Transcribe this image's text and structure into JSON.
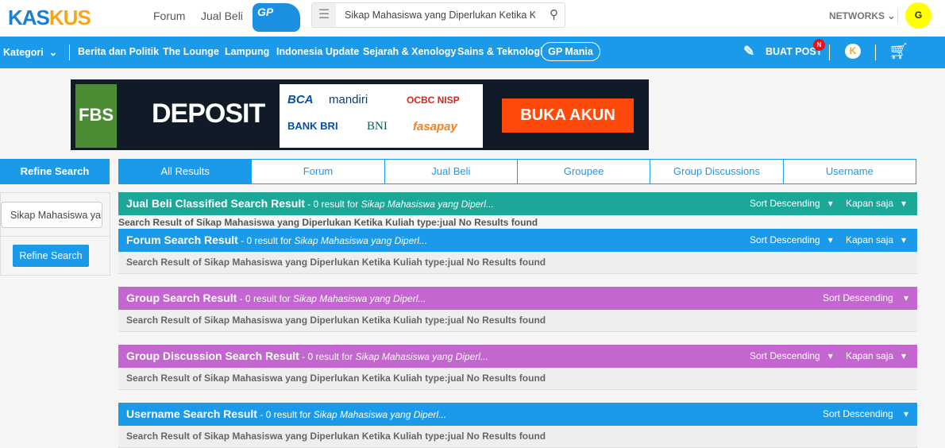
{
  "header": {
    "logo": "KASKUS",
    "links": [
      "Forum",
      "Jual Beli"
    ],
    "gp_logo": "GP",
    "search_value": "Sikap Mahasiswa yang Diperlukan Ketika Ku",
    "networks": "NETWORKS",
    "avatar": "G"
  },
  "nav": {
    "kategori": "Kategori",
    "items": [
      "Berita dan Politik",
      "The Lounge",
      "Lampung",
      "Indonesia Update",
      "Sejarah & Xenology",
      "Sains & Teknologi"
    ],
    "gp_mania": "GP Mania",
    "buat_post": "BUAT POST",
    "badge": "N"
  },
  "ad": {
    "brand": "FBS",
    "title": "DEPOSIT",
    "banks": [
      "BCA",
      "mandiri",
      "OCBC NISP",
      "BANK BRI",
      "BNI",
      "fasapay"
    ],
    "cta": "BUKA AKUN"
  },
  "sidebar": {
    "title": "Refine Search",
    "input_value": "Sikap Mahasiswa yang Diperlukan Ketika Kuliah",
    "button": "Refine Search"
  },
  "tabs": [
    "All Results",
    "Forum",
    "Jual Beli",
    "Groupee",
    "Group Discussions",
    "Username"
  ],
  "sections": [
    {
      "title": "Jual Beli Classified Search Result",
      "meta": " - 0 result for ",
      "query": "Sikap Mahasiswa yang Diperl...",
      "sort": "Sort Descending",
      "time": "Kapan saja",
      "body": "Search Result of Sikap Mahasiswa yang Diperlukan Ketika Kuliah type:jual No Results found",
      "color": "#1ba898"
    },
    {
      "title": "Forum Search Result",
      "meta": " - 0 result for ",
      "query": "Sikap Mahasiswa yang Diperl...",
      "sort": "Sort Descending",
      "time": "Kapan saja",
      "body": "Search Result of Sikap Mahasiswa yang Diperlukan Ketika Kuliah type:jual No Results found",
      "color": "#1c9aea"
    },
    {
      "title": "Group Search Result",
      "meta": " - 0 result for ",
      "query": "Sikap Mahasiswa yang Diperl...",
      "sort": "Sort Descending",
      "body": "Search Result of Sikap Mahasiswa yang Diperlukan Ketika Kuliah type:jual No Results found",
      "color": "#c466cf"
    },
    {
      "title": "Group Discussion Search Result",
      "meta": " - 0 result for ",
      "query": "Sikap Mahasiswa yang Diperl...",
      "sort": "Sort Descending",
      "time": "Kapan saja",
      "body": "Search Result of Sikap Mahasiswa yang Diperlukan Ketika Kuliah type:jual No Results found",
      "color": "#c466cf"
    },
    {
      "title": "Username Search Result",
      "meta": " - 0 result for ",
      "query": "Sikap Mahasiswa yang Diperl...",
      "sort": "Sort Descending",
      "body": "Search Result of Sikap Mahasiswa yang Diperlukan Ketika Kuliah type:jual No Results found",
      "color": "#1c9aea"
    }
  ]
}
